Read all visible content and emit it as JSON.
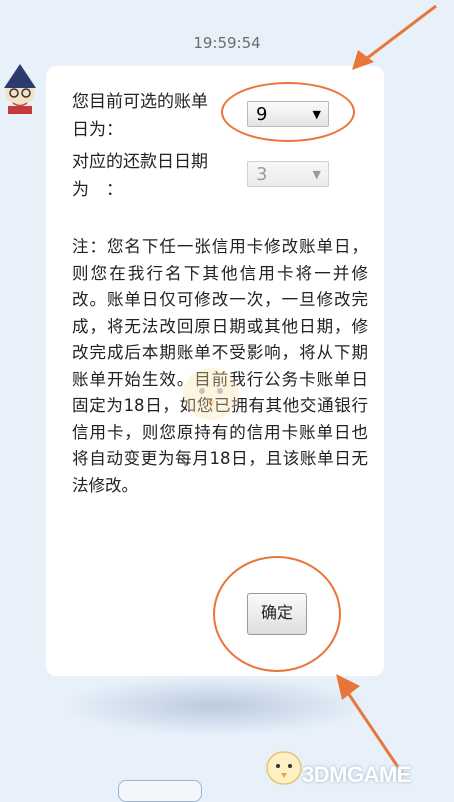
{
  "chat": {
    "timestamp": "19:59:54"
  },
  "billing_form": {
    "bill_day_label_line1": "您目前可选的账单",
    "bill_day_label_line2": "日为：",
    "bill_day_value": "9",
    "repay_day_label_line1": "对应的还款日日期",
    "repay_day_label_line2": "为　：",
    "repay_day_value": "3",
    "note": "注：您名下任一张信用卡修改账单日，则您在我行名下其他信用卡将一并修改。账单日仅可修改一次，一旦修改完成，将无法改回原日期或其他日期，修改完成后本期账单不受影响，将从下期账单开始生效。目前我行公务卡账单日固定为18日，如您已拥有其他交通银行信用卡，则您原持有的信用卡账单日也将自动变更为每月18日，且该账单日无法修改。",
    "confirm_label": "确定"
  },
  "watermark": {
    "text": "3DMGAME"
  },
  "colors": {
    "annotation": "#e8763a",
    "background": "#e8f1fa"
  }
}
